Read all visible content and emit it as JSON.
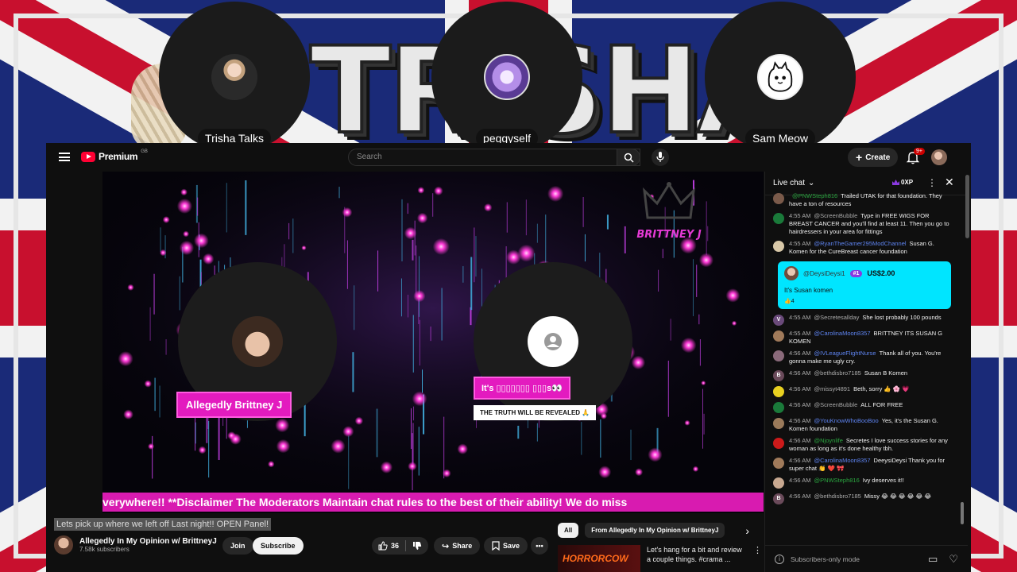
{
  "banner": {
    "text": "TRISHA"
  },
  "participants": [
    {
      "name": "Trisha Talks"
    },
    {
      "name": "peggyself"
    },
    {
      "name": "Sam Meow"
    }
  ],
  "youtube": {
    "logo": "Premium",
    "logo_sup": "GB",
    "search_placeholder": "Search",
    "create_label": "Create",
    "notifications": "9+",
    "video": {
      "crown_text": "BRITTNEY J",
      "host_name": "Allegedly Brittney J",
      "guest_name": "It's ▯▯▯▯▯▯▯ ▯▯▯s👀",
      "guest_sub": "THE TRUTH WILL BE REVEALED 🙏",
      "ticker": "verywhere!! **Disclaimer The Moderators Maintain chat rules to the best of their ability! We do miss"
    },
    "title": "Lets pick up where we left off Last night!! OPEN Panel!",
    "channel": {
      "name": "Allegedly In My Opinion w/ BrittneyJ",
      "subscribers": "7.58k subscribers"
    },
    "buttons": {
      "join": "Join",
      "subscribe": "Subscribe",
      "likes": "36",
      "share": "Share",
      "save": "Save"
    },
    "chips": [
      "All",
      "From Allegedly In My Opinion w/ BrittneyJ"
    ],
    "recommended": {
      "thumb_text": "HORRORCOW",
      "title": "Let's hang for a bit and review a couple things. #crama ..."
    }
  },
  "chat": {
    "header": "Live chat",
    "xp": "0XP",
    "footer": "Subscribers-only mode",
    "colors": {
      "superchat": "#00e5ff",
      "mod": "#5e84f1",
      "member": "#2ba640"
    },
    "messages_top": [
      {
        "time": "",
        "author": "@PNWSteph816",
        "role": "member",
        "text": "Trailed UTAK for that foundation. They have a ton of resources",
        "avatar": "#7a5a4a"
      },
      {
        "time": "4:55 AM",
        "author": "@ScreenBubble",
        "role": "",
        "text": "Type in FREE WIGS FOR BREAST CANCER and you'll find at least 11. Then you go to hairdressers in your area for fittings",
        "avatar": "#1a7a3a"
      },
      {
        "time": "4:55 AM",
        "author": "@RyanTheGamer295ModChannel",
        "role": "mod",
        "text": "Susan G. Komen for the CureBreast cancer foundation",
        "avatar": "#d8c8a8"
      }
    ],
    "superchat": {
      "author": "@DeysiDeysi1",
      "rank": "#1",
      "amount": "US$2.00",
      "message": "It's Susan komen",
      "likes": "4"
    },
    "messages_bottom": [
      {
        "time": "4:55 AM",
        "author": "@Secretesallday",
        "role": "",
        "text": "She lost probably 100 pounds",
        "avatar": "#6a4a7a",
        "initial": "V"
      },
      {
        "time": "4:55 AM",
        "author": "@CarolinaMoon8357",
        "role": "mod",
        "text": "BRITTNEY ITS SUSAN G KOMEN",
        "avatar": "#a07a5a"
      },
      {
        "time": "4:56 AM",
        "author": "@IVLeagueFlightNurse",
        "role": "mod",
        "text": "Thank all of you. You're gonna make me ugly cry.",
        "avatar": "#8a6a7a"
      },
      {
        "time": "4:56 AM",
        "author": "@bethdisbro7185",
        "role": "",
        "text": "Susan B Komen",
        "avatar": "#6a4a5a",
        "initial": "B"
      },
      {
        "time": "4:56 AM",
        "author": "@missyt4891",
        "role": "",
        "text": "Beth, sorry 👍 🌸 💗",
        "avatar": "#e8d020"
      },
      {
        "time": "4:56 AM",
        "author": "@ScreenBubble",
        "role": "",
        "text": "ALL FOR FREE",
        "avatar": "#1a7a3a"
      },
      {
        "time": "4:56 AM",
        "author": "@YouKnowWhoBooBoo",
        "role": "mod",
        "text": "Yes, it's the Susan G. Komen foundation",
        "avatar": "#9a7a5a"
      },
      {
        "time": "4:56 AM",
        "author": "@Njoynlife",
        "role": "member",
        "text": "Secretes I love success stories for any woman as long as it's done healthy tbh.",
        "avatar": "#cc1a1a"
      },
      {
        "time": "4:56 AM",
        "author": "@CarolinaMoon8357",
        "role": "mod",
        "text": "DeeysiDeysi Thank you for super chat 👏 ❤️ 🎀",
        "avatar": "#a07a5a"
      },
      {
        "time": "4:56 AM",
        "author": "@PNWSteph816",
        "role": "member",
        "text": "Ivy deserves it!!",
        "avatar": "#c8a890"
      },
      {
        "time": "4:56 AM",
        "author": "@bethdisbro7185",
        "role": "",
        "text": "Missy 😂 😂 😂 😂 😂 😂",
        "avatar": "#6a4a5a",
        "initial": "B"
      }
    ]
  }
}
